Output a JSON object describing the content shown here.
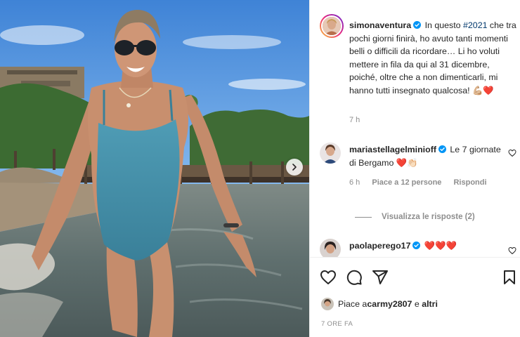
{
  "post": {
    "username": "simonaventura",
    "caption_pre": " In questo ",
    "hashtag": "#2021",
    "caption_post": " che tra pochi giorni finirà, ho avuto tanti momenti belli o difficili da ricordare… Li ho voluti mettere in fila da qui al 31 dicembre, poiché, oltre che a non dimenticarli, mi hanno tutti insegnato qualcosa! 💪🏼❤️",
    "age": "7 h"
  },
  "comments": [
    {
      "username": "mariastellagelminioff",
      "text": " Le 7 giornate di Bergamo ❤️👏🏻",
      "age": "6 h",
      "likes": "Piace a 12 persone",
      "reply": "Rispondi",
      "view_replies": "Visualizza le risposte (2)"
    },
    {
      "username": "paolaperego17",
      "text": " ❤️❤️❤️"
    }
  ],
  "likes_line": {
    "prefix": "Piace a ",
    "user": "carmy2807",
    "connector": " e ",
    "suffix": "altri"
  },
  "timestamp": "7 ORE FA",
  "icons": {
    "like": "heart-icon",
    "comment": "comment-icon",
    "share": "paper-plane-icon",
    "save": "bookmark-icon",
    "next": "chevron-right-icon",
    "verified": "verified-badge-icon"
  },
  "colors": {
    "verified": "#0095f6",
    "heart_red": "#ed4956",
    "hashtag": "#00376b",
    "muted": "#8e8e8e"
  }
}
